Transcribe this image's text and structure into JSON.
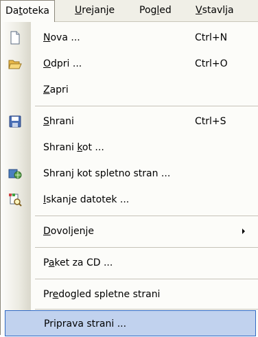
{
  "menubar": {
    "items": [
      {
        "pre": "Da",
        "key": "t",
        "post": "oteka"
      },
      {
        "pre": "",
        "key": "U",
        "post": "rejanje"
      },
      {
        "pre": "Pog",
        "key": "l",
        "post": "ed"
      },
      {
        "pre": "",
        "key": "V",
        "post": "stavlja"
      }
    ]
  },
  "menu": {
    "items": [
      {
        "pre": "",
        "key": "N",
        "post": "ova ...",
        "shortcut": "Ctrl+N",
        "icon": "new-document-icon"
      },
      {
        "pre": "",
        "key": "O",
        "post": "dpri ...",
        "shortcut": "Ctrl+O",
        "icon": "open-folder-icon"
      },
      {
        "pre": "",
        "key": "Z",
        "post": "apri",
        "shortcut": ""
      },
      {
        "pre": "",
        "key": "S",
        "post": "hrani",
        "shortcut": "Ctrl+S",
        "icon": "save-disk-icon"
      },
      {
        "pre": "Shrani ",
        "key": "k",
        "post": "ot ...",
        "shortcut": ""
      },
      {
        "pre": "Shran",
        "key": "j",
        "post": " kot spletno stran ...",
        "shortcut": "",
        "icon": "web-page-icon"
      },
      {
        "pre": "",
        "key": "I",
        "post": "skanje datotek ...",
        "shortcut": "",
        "icon": "file-search-icon"
      },
      {
        "pre": "",
        "key": "D",
        "post": "ovoljenje",
        "shortcut": ""
      },
      {
        "pre": "P",
        "key": "a",
        "post": "ket za CD ...",
        "shortcut": ""
      },
      {
        "pre": "Pr",
        "key": "e",
        "post": "dogled spletne strani",
        "shortcut": ""
      },
      {
        "pre": "Priprava strani ...",
        "key": "",
        "post": "",
        "shortcut": ""
      }
    ]
  }
}
